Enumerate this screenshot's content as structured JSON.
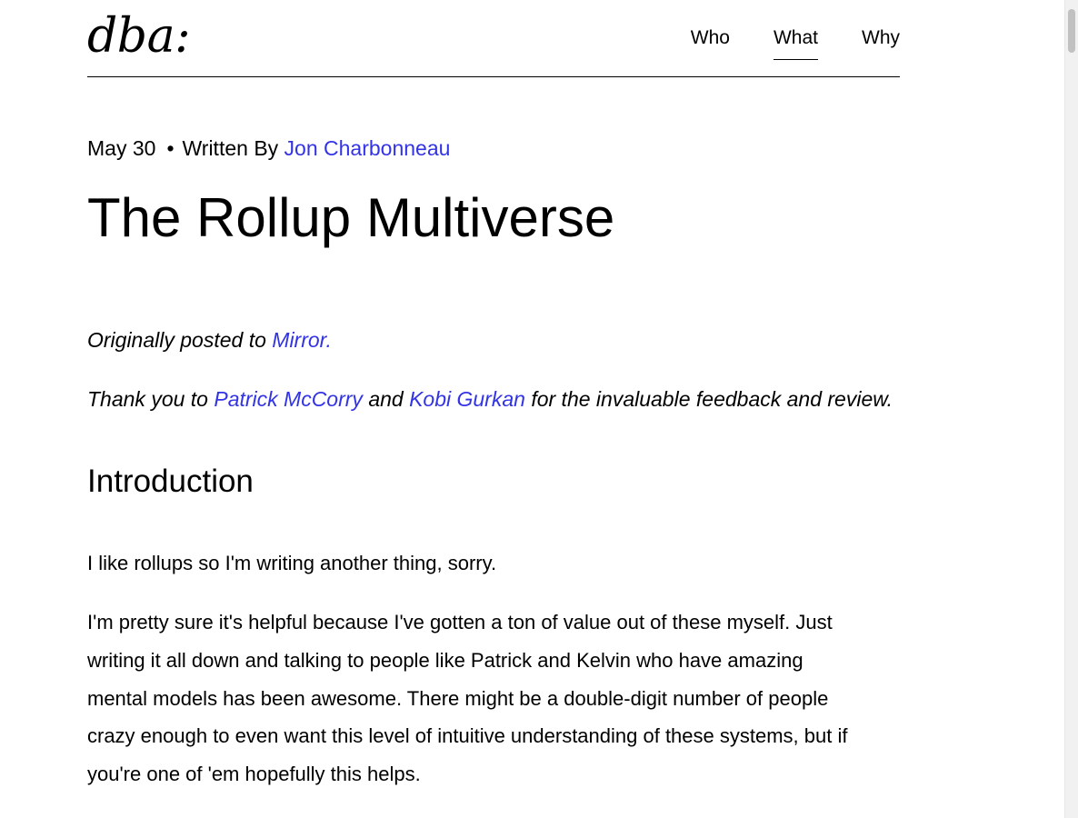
{
  "header": {
    "logo": "dba:",
    "nav": [
      {
        "label": "Who",
        "active": false
      },
      {
        "label": "What",
        "active": true
      },
      {
        "label": "Why",
        "active": false
      }
    ]
  },
  "post": {
    "date": "May 30",
    "separator": "•",
    "written_by": "Written By",
    "author": "Jon Charbonneau",
    "title": "The Rollup Multiverse",
    "originally_posted_prefix": "Originally posted to",
    "originally_posted_link": "Mirror.",
    "thanks_prefix": "Thank you to",
    "thanks_person_1": "Patrick McCorry",
    "thanks_and": "and",
    "thanks_person_2": "Kobi Gurkan",
    "thanks_suffix": "for the invaluable feedback and review.",
    "section_heading": "Introduction",
    "paragraph_1": "I like rollups so I'm writing another thing, sorry.",
    "paragraph_2_lines": [
      "I'm pretty sure it's helpful because I've gotten a ton of value out of these myself. Just",
      "writing it all down and talking to people like Patrick and Kelvin who have amazing",
      "mental models has been awesome. There might be a double-digit number of people",
      "crazy enough to even want this level of intuitive understanding of these systems, but if",
      "you're one of 'em hopefully this helps."
    ]
  },
  "colors": {
    "link": "#3333e6",
    "text": "#000000",
    "background": "#ffffff"
  }
}
